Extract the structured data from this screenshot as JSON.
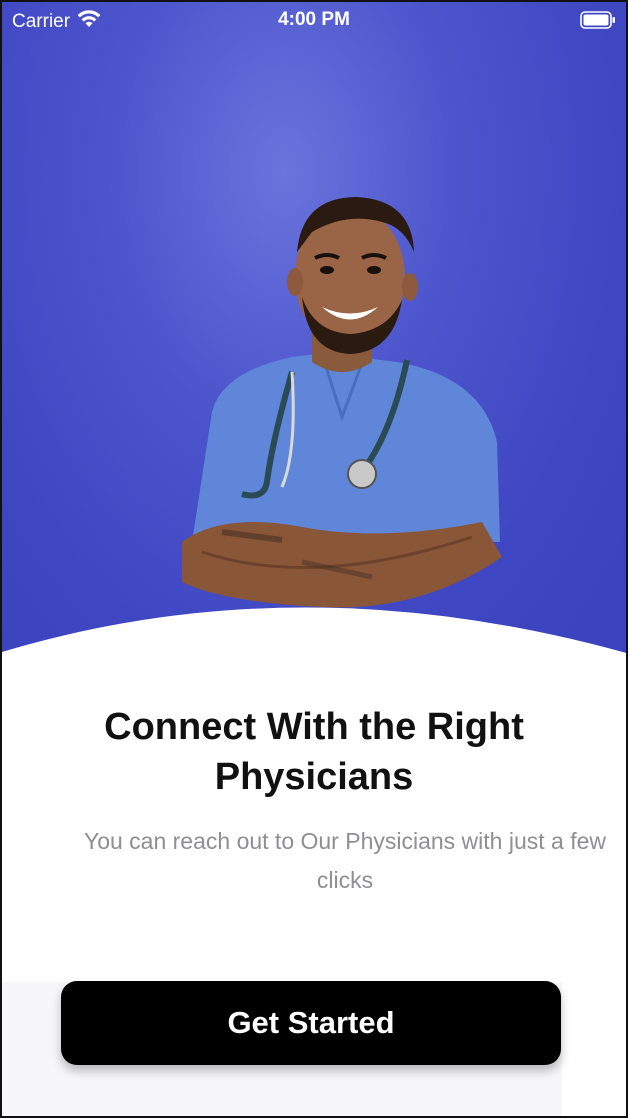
{
  "status_bar": {
    "carrier": "Carrier",
    "time": "4:00 PM",
    "wifi_icon": "wifi-icon",
    "battery_icon": "battery-icon"
  },
  "hero": {
    "background_color": "#4d55cd",
    "image": "doctor-photo"
  },
  "onboarding": {
    "title": "Connect With the Right Physicians",
    "subtitle": "You can reach out to Our Physicians with just a few clicks"
  },
  "cta": {
    "label": "Get Started",
    "background": "#000000",
    "text_color": "#ffffff"
  }
}
